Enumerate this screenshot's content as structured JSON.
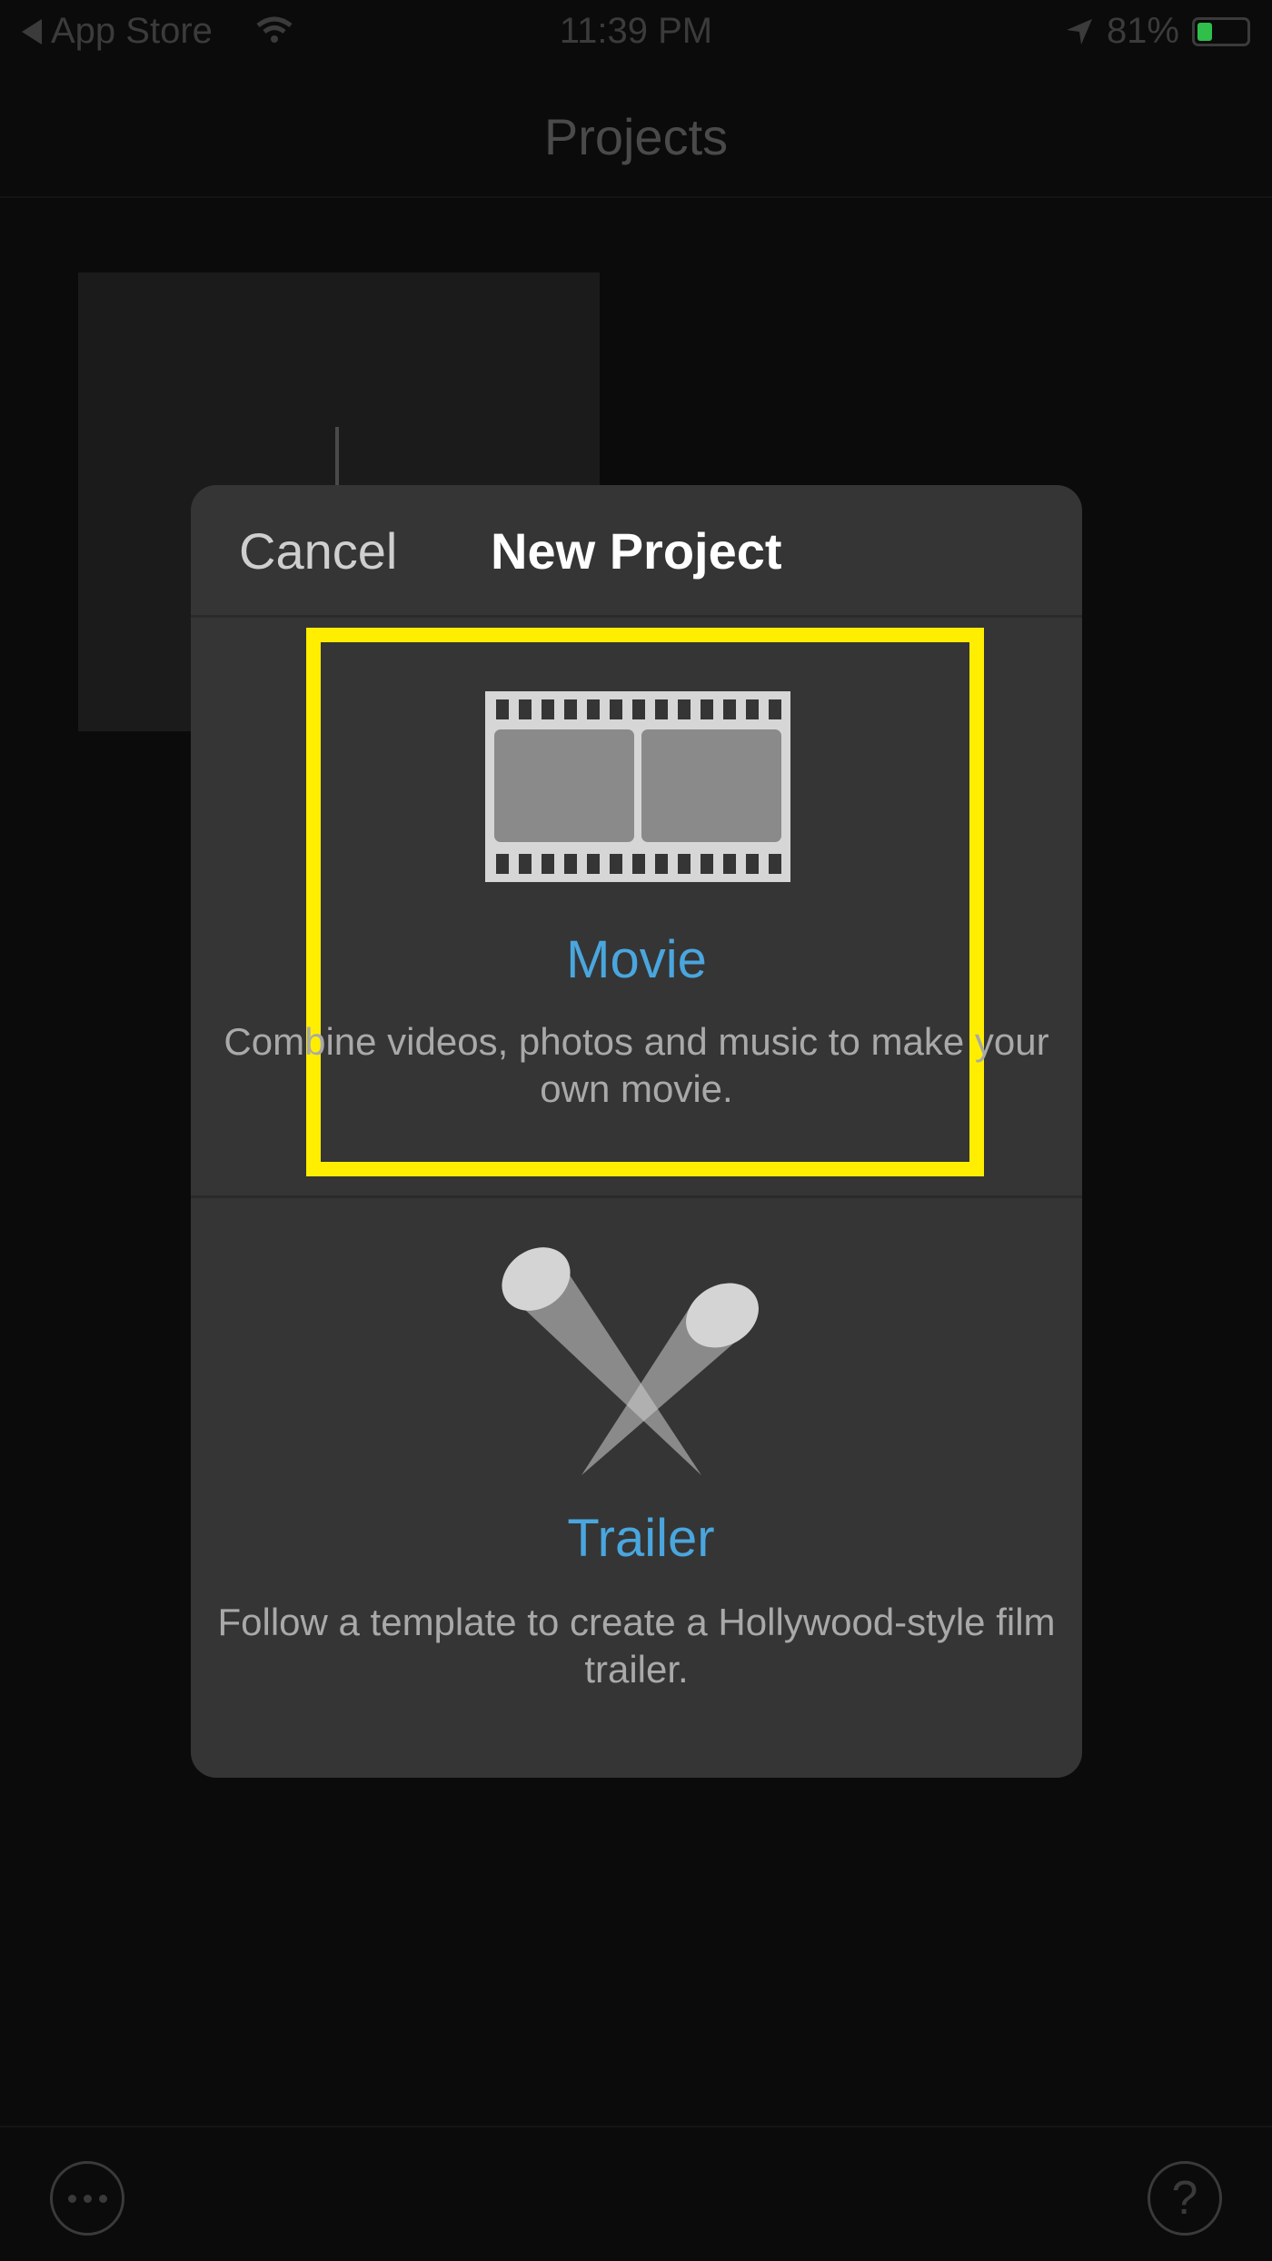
{
  "status_bar": {
    "back_label": "App Store",
    "time": "11:39 PM",
    "battery": "81%"
  },
  "nav": {
    "title": "Projects"
  },
  "modal": {
    "cancel_label": "Cancel",
    "title": "New Project",
    "options": [
      {
        "title": "Movie",
        "description": "Combine videos, photos and music to make your own movie.",
        "icon": "film-strip-icon"
      },
      {
        "title": "Trailer",
        "description": "Follow a template to create a Hollywood-style film trailer.",
        "icon": "spotlights-icon"
      }
    ]
  },
  "toolbar": {
    "more_icon": "ellipsis-icon",
    "help_label": "?"
  },
  "colors": {
    "accent": "#4aa6de",
    "highlight": "#ffee00",
    "modal_bg": "#353535",
    "battery": "#2fbf4a"
  }
}
